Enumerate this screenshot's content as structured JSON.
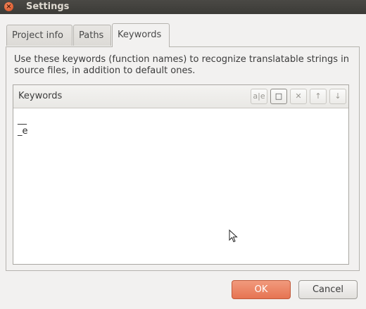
{
  "window": {
    "title": "Settings"
  },
  "tabs": [
    {
      "label": "Project info",
      "active": false
    },
    {
      "label": "Paths",
      "active": false
    },
    {
      "label": "Keywords",
      "active": true
    }
  ],
  "description": "Use these keywords (function names) to recognize translatable strings in source files, in addition to default ones.",
  "keywords_panel": {
    "header": "Keywords",
    "toolbar": [
      {
        "icon": "rename-icon",
        "glyph": "a|e",
        "enabled": false
      },
      {
        "icon": "new-item-icon",
        "glyph": "□",
        "enabled": true
      },
      {
        "icon": "delete-icon",
        "glyph": "✕",
        "enabled": false
      },
      {
        "icon": "move-up-icon",
        "glyph": "↑",
        "enabled": false
      },
      {
        "icon": "move-down-icon",
        "glyph": "↓",
        "enabled": false
      }
    ],
    "items": [
      "__",
      "_e"
    ]
  },
  "buttons": {
    "ok": "OK",
    "cancel": "Cancel"
  }
}
